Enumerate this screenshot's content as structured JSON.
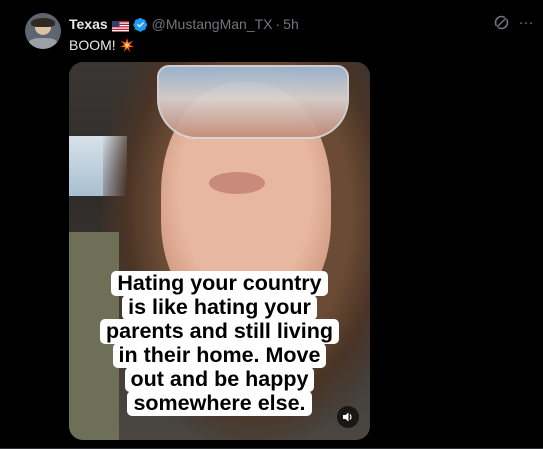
{
  "tweet": {
    "display_name": "Texas",
    "flag_icon": "us-flag-icon",
    "verified_icon": "verified-badge-icon",
    "handle": "@MustangMan_TX",
    "separator": "·",
    "timestamp": "5h",
    "text": "BOOM!",
    "text_icon": "collision-icon",
    "accent_color": "#1d9bf0"
  },
  "header_actions": {
    "grok_icon": "grok-icon",
    "more_icon": "more-icon",
    "more_label": "···"
  },
  "media": {
    "caption_lines": [
      "Hating your country",
      "is like hating your",
      "parents and still living",
      "in their home. Move",
      "out and be happy",
      "somewhere else."
    ],
    "audio_icon": "speaker-icon"
  }
}
